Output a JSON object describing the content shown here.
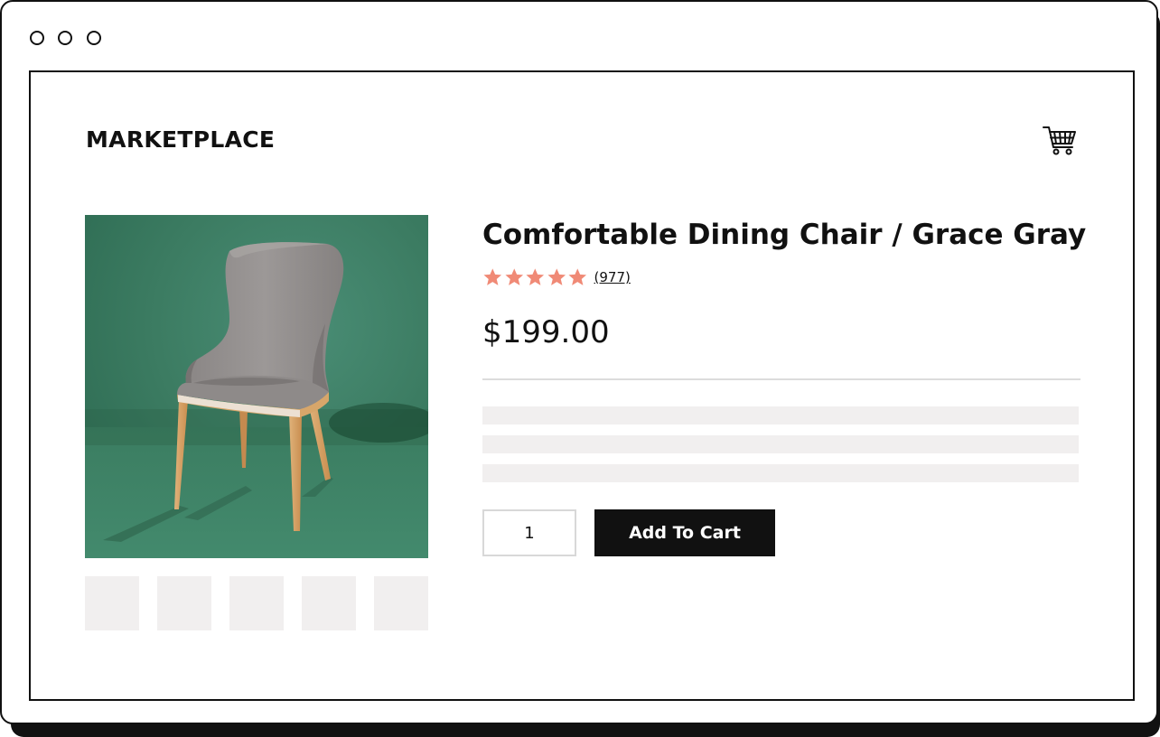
{
  "header": {
    "brand": "MARKETPLACE",
    "cart_icon": "shopping-cart-icon"
  },
  "product": {
    "title": "Comfortable Dining Chair / Grace Gray",
    "rating": {
      "stars": 5,
      "max": 5,
      "reviews": "(977)"
    },
    "price": "$199.00",
    "image": "gray-dining-chair-photo",
    "thumbnail_count": 5,
    "description_placeholder_lines": 3
  },
  "cart_form": {
    "quantity": "1",
    "add_label": "Add To Cart"
  },
  "colors": {
    "star": "#f08a76",
    "image_bg": "#3f8468",
    "button_bg": "#111111",
    "placeholder": "#f1efef"
  }
}
